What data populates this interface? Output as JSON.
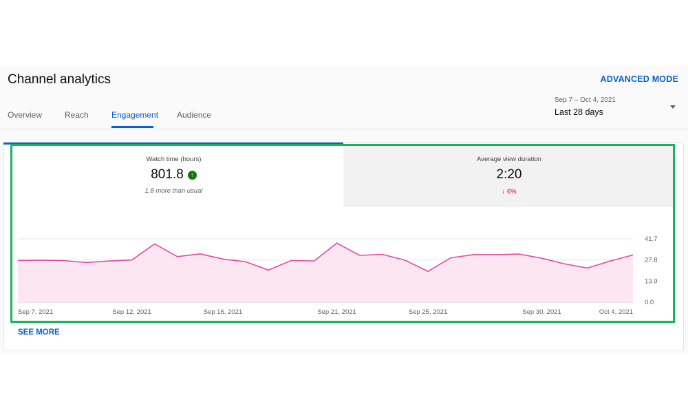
{
  "header": {
    "title": "Channel analytics",
    "advanced_mode": "ADVANCED MODE"
  },
  "tabs": [
    {
      "label": "Overview",
      "active": false
    },
    {
      "label": "Reach",
      "active": false
    },
    {
      "label": "Engagement",
      "active": true
    },
    {
      "label": "Audience",
      "active": false
    }
  ],
  "date_selector": {
    "range": "Sep 7 – Oct 4, 2021",
    "period": "Last 28 days",
    "icon": "caret-down-icon"
  },
  "metrics": [
    {
      "label": "Watch time (hours)",
      "value": "801.8",
      "trend_icon": "arrow-up-icon",
      "note": "1.8 more than usual",
      "selected": true
    },
    {
      "label": "Average view duration",
      "value": "2:20",
      "trend_icon": "arrow-down-icon",
      "delta": "6%",
      "selected": false
    }
  ],
  "see_more": "SEE MORE",
  "colors": {
    "accent": "#065fd4",
    "line": "#e04ba0",
    "area": "#fbe6f1",
    "positive": "#0b7a0b",
    "negative": "#cc0000",
    "highlight_box": "#17b55a"
  },
  "chart_data": {
    "type": "area",
    "title": "",
    "xlabel": "",
    "ylabel": "",
    "y_ticks": [
      "41.7",
      "27.8",
      "13.9",
      "0.0"
    ],
    "ylim": [
      0,
      41.7
    ],
    "x_tick_labels": [
      "Sep 7, 2021",
      "Sep 12, 2021",
      "Sep 16, 2021",
      "Sep 21, 2021",
      "Sep 25, 2021",
      "Sep 30, 2021",
      "Oct 4, 2021"
    ],
    "x_tick_days": [
      0,
      5,
      9,
      14,
      18,
      23,
      27
    ],
    "grid": true,
    "series": [
      {
        "values": [
          27.4,
          27.7,
          27.4,
          26.1,
          27.1,
          27.8,
          38.4,
          30.0,
          31.8,
          28.4,
          26.6,
          21.1,
          27.4,
          27.1,
          38.9,
          30.8,
          31.5,
          27.6,
          20.3,
          29.2,
          31.3,
          31.3,
          31.7,
          28.9,
          25.2,
          22.5,
          27.1,
          31.1
        ]
      }
    ]
  }
}
